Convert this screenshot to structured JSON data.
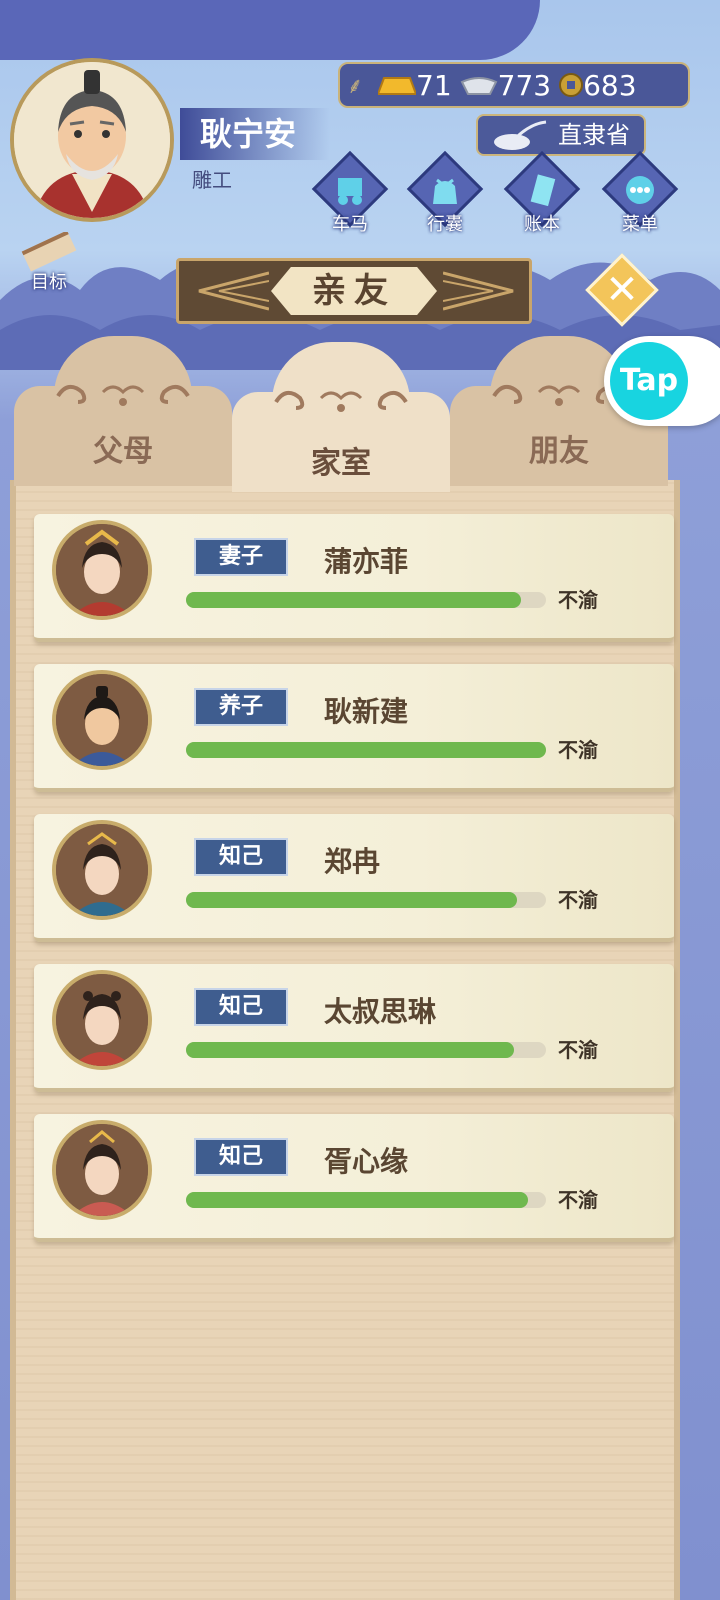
{
  "player": {
    "name": "耿宁安",
    "profession": "雕工"
  },
  "currency": {
    "gold": "71",
    "silver": "773",
    "coins": "683"
  },
  "location": "直隶省",
  "nav_buttons": [
    {
      "label": "车马",
      "icon": "carriage-icon"
    },
    {
      "label": "行囊",
      "icon": "bag-icon"
    },
    {
      "label": "账本",
      "icon": "ledger-icon"
    },
    {
      "label": "菜单",
      "icon": "menu-dots-icon"
    }
  ],
  "goal_label": "目标",
  "title": "亲友",
  "tabs": [
    {
      "label": "父母",
      "active": false
    },
    {
      "label": "家室",
      "active": true
    },
    {
      "label": "朋友",
      "active": false
    }
  ],
  "tap_badge": "Tap",
  "relations": [
    {
      "relation": "妻子",
      "name": "蒲亦菲",
      "mood": "不渝",
      "affection": 0.93
    },
    {
      "relation": "养子",
      "name": "耿新建",
      "mood": "不渝",
      "affection": 1.0
    },
    {
      "relation": "知己",
      "name": "郑冉",
      "mood": "不渝",
      "affection": 0.92
    },
    {
      "relation": "知己",
      "name": "太叔思琳",
      "mood": "不渝",
      "affection": 0.91
    },
    {
      "relation": "知己",
      "name": "胥心缘",
      "mood": "不渝",
      "affection": 0.95
    }
  ],
  "colors": {
    "progress_fill": "#6fb84e",
    "relation_badge": "#3f5d8f",
    "panel_wood": "#e8d4b7"
  }
}
